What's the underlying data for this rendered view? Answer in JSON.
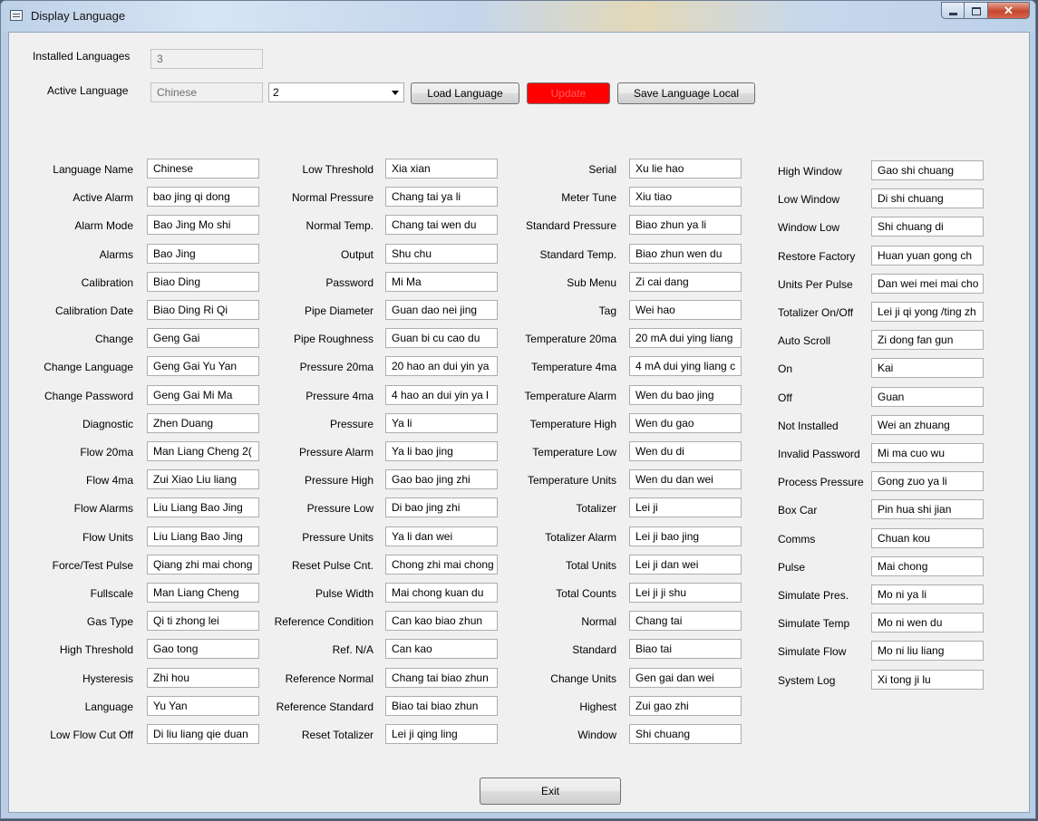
{
  "window": {
    "title": "Display Language",
    "controls": [
      "minimize",
      "maximize",
      "close"
    ]
  },
  "top": {
    "installed_label": "Installed Languages",
    "installed_value": "3",
    "active_label": "Active Language",
    "active_value": "Chinese",
    "combo_value": "2",
    "load_button": "Load Language",
    "update_button": "Update",
    "update_color": "#ff0000",
    "save_button": "Save Language Local"
  },
  "columns": [
    {
      "fields": [
        {
          "label": "Language Name",
          "value": "Chinese"
        },
        {
          "label": "Active Alarm",
          "value": "bao jing qi dong"
        },
        {
          "label": "Alarm Mode",
          "value": "Bao Jing Mo shi"
        },
        {
          "label": "Alarms",
          "value": "Bao Jing"
        },
        {
          "label": "Calibration",
          "value": "Biao Ding"
        },
        {
          "label": "Calibration Date",
          "value": "Biao Ding Ri Qi"
        },
        {
          "label": "Change",
          "value": "Geng Gai"
        },
        {
          "label": "Change Language",
          "value": "Geng Gai Yu Yan"
        },
        {
          "label": "Change Password",
          "value": "Geng Gai Mi Ma"
        },
        {
          "label": "Diagnostic",
          "value": "Zhen Duang"
        },
        {
          "label": "Flow 20ma",
          "value": "Man Liang Cheng 2("
        },
        {
          "label": "Flow 4ma",
          "value": "Zui Xiao Liu liang"
        },
        {
          "label": "Flow Alarms",
          "value": "Liu Liang Bao Jing"
        },
        {
          "label": "Flow Units",
          "value": "Liu Liang Bao Jing"
        },
        {
          "label": "Force/Test Pulse",
          "value": "Qiang zhi mai chong"
        },
        {
          "label": "Fullscale",
          "value": "Man Liang Cheng"
        },
        {
          "label": "Gas Type",
          "value": "Qi ti zhong lei"
        },
        {
          "label": "High Threshold",
          "value": "Gao tong"
        },
        {
          "label": "Hysteresis",
          "value": "Zhi hou"
        },
        {
          "label": "Language",
          "value": "Yu Yan"
        },
        {
          "label": "Low Flow Cut Off",
          "value": "Di liu liang qie duan"
        }
      ]
    },
    {
      "fields": [
        {
          "label": "Low Threshold",
          "value": "Xia xian"
        },
        {
          "label": "Normal Pressure",
          "value": "Chang tai ya li"
        },
        {
          "label": "Normal Temp.",
          "value": "Chang tai wen du"
        },
        {
          "label": "Output",
          "value": "Shu chu"
        },
        {
          "label": "Password",
          "value": "Mi Ma"
        },
        {
          "label": "Pipe Diameter",
          "value": "Guan dao nei jing"
        },
        {
          "label": "Pipe Roughness",
          "value": "Guan bi cu cao du"
        },
        {
          "label": "Pressure 20ma",
          "value": "20 hao an dui yin ya"
        },
        {
          "label": "Pressure 4ma",
          "value": "4 hao an dui yin ya l"
        },
        {
          "label": "Pressure",
          "value": "Ya li"
        },
        {
          "label": "Pressure Alarm",
          "value": "Ya li bao jing"
        },
        {
          "label": "Pressure High",
          "value": "Gao bao jing zhi"
        },
        {
          "label": "Pressure Low",
          "value": "Di bao jing zhi"
        },
        {
          "label": "Pressure Units",
          "value": "Ya li dan wei"
        },
        {
          "label": "Reset Pulse Cnt.",
          "value": "Chong zhi mai chong"
        },
        {
          "label": "Pulse Width",
          "value": "Mai chong kuan du"
        },
        {
          "label": "Reference Condition",
          "value": "Can kao biao zhun"
        },
        {
          "label": "Ref. N/A",
          "value": "Can kao"
        },
        {
          "label": "Reference Normal",
          "value": "Chang tai biao zhun"
        },
        {
          "label": "Reference Standard",
          "value": "Biao tai biao zhun"
        },
        {
          "label": "Reset Totalizer",
          "value": "Lei ji qing ling"
        }
      ]
    },
    {
      "fields": [
        {
          "label": "Serial",
          "value": "Xu lie hao"
        },
        {
          "label": "Meter Tune",
          "value": "Xiu tiao"
        },
        {
          "label": "Standard Pressure",
          "value": "Biao zhun ya li"
        },
        {
          "label": "Standard Temp.",
          "value": "Biao zhun wen du"
        },
        {
          "label": "Sub Menu",
          "value": "Zi cai dang"
        },
        {
          "label": "Tag",
          "value": "Wei hao"
        },
        {
          "label": "Temperature 20ma",
          "value": "20 mA dui ying liang"
        },
        {
          "label": "Temperature 4ma",
          "value": "4 mA dui ying liang c"
        },
        {
          "label": "Temperature Alarm",
          "value": "Wen du bao jing"
        },
        {
          "label": "Temperature High",
          "value": "Wen du gao"
        },
        {
          "label": "Temperature Low",
          "value": "Wen du di"
        },
        {
          "label": "Temperature Units",
          "value": "Wen du dan wei"
        },
        {
          "label": "Totalizer",
          "value": "Lei ji"
        },
        {
          "label": "Totalizer Alarm",
          "value": "Lei ji bao jing"
        },
        {
          "label": "Total Units",
          "value": "Lei ji dan wei"
        },
        {
          "label": "Total Counts",
          "value": "Lei ji ji shu"
        },
        {
          "label": "Normal",
          "value": "Chang tai"
        },
        {
          "label": "Standard",
          "value": "Biao tai"
        },
        {
          "label": "Change Units",
          "value": "Gen gai dan wei"
        },
        {
          "label": "Highest",
          "value": "Zui gao zhi"
        },
        {
          "label": "Window",
          "value": "Shi chuang"
        }
      ]
    },
    {
      "fields": [
        {
          "label": "High Window",
          "value": "Gao shi chuang"
        },
        {
          "label": "Low Window",
          "value": "Di shi chuang"
        },
        {
          "label": "Window Low",
          "value": "Shi chuang di"
        },
        {
          "label": "Restore Factory",
          "value": "Huan yuan gong ch"
        },
        {
          "label": "Units Per Pulse",
          "value": "Dan wei mei mai cho"
        },
        {
          "label": "Totalizer On/Off",
          "value": "Lei ji qi yong /ting zh"
        },
        {
          "label": "Auto Scroll",
          "value": "Zi dong fan gun"
        },
        {
          "label": "On",
          "value": "Kai"
        },
        {
          "label": "Off",
          "value": "Guan"
        },
        {
          "label": "Not Installed",
          "value": "Wei an zhuang"
        },
        {
          "label": "Invalid Password",
          "value": "Mi ma cuo wu"
        },
        {
          "label": "Process Pressure",
          "value": "Gong zuo ya li"
        },
        {
          "label": "Box Car",
          "value": "Pin hua shi jian"
        },
        {
          "label": "Comms",
          "value": "Chuan kou"
        },
        {
          "label": "Pulse",
          "value": "Mai chong"
        },
        {
          "label": "Simulate Pres.",
          "value": "Mo ni ya li"
        },
        {
          "label": "Simulate Temp",
          "value": "Mo ni wen du"
        },
        {
          "label": "Simulate Flow",
          "value": "Mo ni liu liang"
        },
        {
          "label": "System Log",
          "value": "Xi tong ji lu"
        }
      ]
    }
  ],
  "exit_button": "Exit"
}
